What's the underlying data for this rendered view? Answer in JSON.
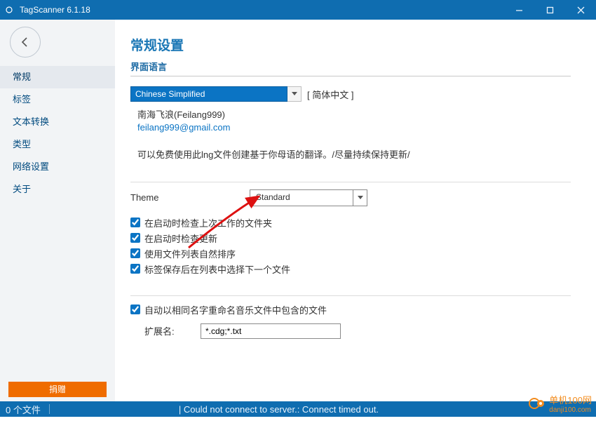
{
  "window": {
    "title": "TagScanner 6.1.18"
  },
  "sidebar": {
    "items": [
      {
        "label": "常规"
      },
      {
        "label": "标签"
      },
      {
        "label": "文本转换"
      },
      {
        "label": "类型"
      },
      {
        "label": "网络设置"
      },
      {
        "label": "关于"
      }
    ],
    "donate": "捐赠"
  },
  "page": {
    "title": "常规设置",
    "lang_section": "界面语言",
    "lang_value": "Chinese Simplified",
    "lang_bracket": "[ 简体中文 ]",
    "author": "南海飞浪(Feilang999)",
    "email": "feilang999@gmail.com",
    "desc": "可以免费使用此lng文件创建基于你母语的翻译。/尽量持续保持更新/",
    "theme_label": "Theme",
    "theme_value": "Standard",
    "checks": [
      "在启动时检查上次工作的文件夹",
      "在启动时检查更新",
      "使用文件列表自然排序",
      "标签保存后在列表中选择下一个文件"
    ],
    "check_rename": "自动以相同名字重命名音乐文件中包含的文件",
    "ext_label": "扩展名:",
    "ext_value": "*.cdg;*.txt"
  },
  "status": {
    "left": "0 个文件",
    "mid": "|  Could not connect to server.: Connect timed out."
  },
  "watermark": {
    "name": "单机100网",
    "url": "danji100.com"
  }
}
